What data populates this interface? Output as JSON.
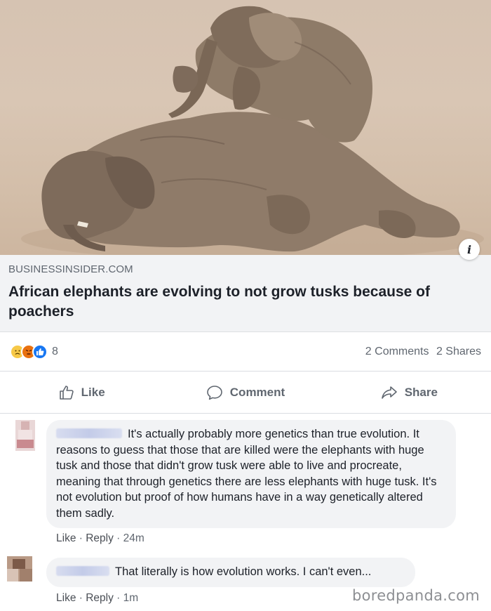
{
  "post": {
    "link": {
      "domain": "BUSINESSINSIDER.COM",
      "headline": "African elephants are evolving to not grow tusks because of poachers",
      "info_icon": "i"
    },
    "reactions": {
      "icons": [
        "sad-reaction",
        "angry-reaction",
        "like-reaction"
      ],
      "count": "8",
      "comments": "2 Comments",
      "shares": "2 Shares"
    },
    "actions": {
      "like": "Like",
      "comment": "Comment",
      "share": "Share"
    }
  },
  "comments": [
    {
      "text": "It's actually probably more genetics than true evolution. It reasons to guess that those that are killed were the elephants with huge tusk and those that didn't grow tusk were able to live and procreate, meaning that through genetics there are less elephants with huge tusk. It's not evolution but proof of how humans have in a way genetically altered them sadly.",
      "like": "Like",
      "reply": "Reply",
      "time": "24m"
    },
    {
      "text": "That literally is how evolution works. I can't even...",
      "like": "Like",
      "reply": "Reply",
      "time": "1m"
    }
  ],
  "watermark": "boredpanda.com",
  "colors": {
    "secondary_text": "#606770",
    "bubble_bg": "#f2f3f5",
    "like_blue": "#1877f2"
  }
}
